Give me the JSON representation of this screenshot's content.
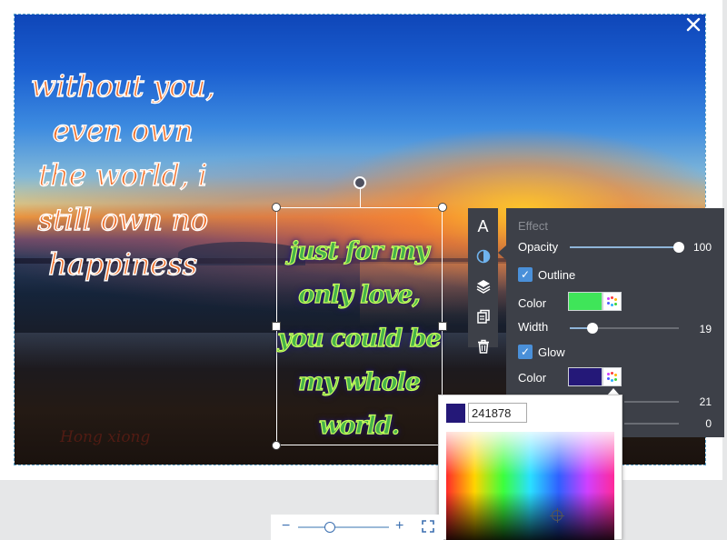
{
  "canvas": {
    "quote_left": [
      "without you,",
      "even own",
      "the world, i",
      "still own no",
      "happiness"
    ],
    "quote_right": [
      "just for my",
      "only love,",
      "you could be",
      "my whole",
      "world."
    ],
    "signature": "Hong xiong"
  },
  "close_icon": "close-icon",
  "toolbar": {
    "items": [
      "text-icon",
      "effect-icon",
      "layers-icon",
      "duplicate-icon",
      "delete-icon"
    ],
    "text_glyph": "A"
  },
  "effect": {
    "title": "Effect",
    "opacity_label": "Opacity",
    "opacity_value": "100",
    "opacity_fraction": 1.0,
    "outline_label": "Outline",
    "outline_checked": true,
    "outline_color_label": "Color",
    "outline_color": "#3fe559",
    "width_label": "Width",
    "width_value": "19",
    "glow_label": "Glow",
    "glow_checked": true,
    "glow_color_label": "Color",
    "glow_color": "#241878",
    "glow_value_1": "21",
    "glow_value_2": "0"
  },
  "color_picker": {
    "hex_value": "241878",
    "swatch_color": "#241878"
  },
  "zoom": {
    "minus": "−",
    "plus": "+",
    "level_fraction": 0.35
  }
}
